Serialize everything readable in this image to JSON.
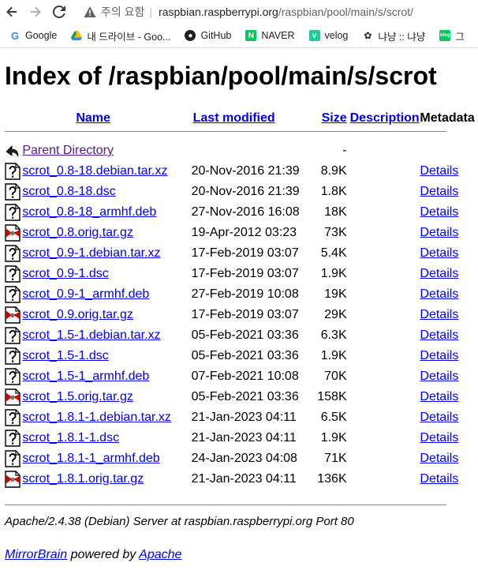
{
  "browser": {
    "back_icon": "arrow-left-icon",
    "forward_icon": "arrow-right-icon",
    "reload_icon": "reload-icon",
    "security_label": "주의 요함",
    "url_host": "raspbian.raspberrypi.org",
    "url_path": "/raspbian/pool/main/s/scrot/"
  },
  "bookmarks": [
    {
      "label": "Google",
      "icon": "google-icon"
    },
    {
      "label": "내 드라이브 - Goo...",
      "icon": "drive-icon"
    },
    {
      "label": "GitHub",
      "icon": "github-icon"
    },
    {
      "label": "NAVER",
      "icon": "naver-icon"
    },
    {
      "label": "velog",
      "icon": "velog-icon"
    },
    {
      "label": "냐냥 :: 냐냥",
      "icon": "bookmark-icon"
    },
    {
      "label": "그",
      "icon": "blog-icon"
    }
  ],
  "page": {
    "title": "Index of /raspbian/pool/main/s/scrot",
    "headers": {
      "name": "Name",
      "last_modified": "Last modified",
      "size": "Size",
      "description": "Description",
      "metadata": "Metadata"
    },
    "parent": {
      "label": "Parent Directory",
      "size": "-"
    },
    "rows": [
      {
        "name": "scrot_0.8-18.debian.tar.xz",
        "date": "20-Nov-2016 21:39",
        "size": "8.9K",
        "details": "Details",
        "kind": "unknown"
      },
      {
        "name": "scrot_0.8-18.dsc",
        "date": "20-Nov-2016 21:39",
        "size": "1.8K",
        "details": "Details",
        "kind": "unknown"
      },
      {
        "name": "scrot_0.8-18_armhf.deb",
        "date": "27-Nov-2016 16:08",
        "size": "18K",
        "details": "Details",
        "kind": "unknown"
      },
      {
        "name": "scrot_0.8.orig.tar.gz",
        "date": "19-Apr-2012 03:23",
        "size": "73K",
        "details": "Details",
        "kind": "compressed"
      },
      {
        "name": "scrot_0.9-1.debian.tar.xz",
        "date": "17-Feb-2019 03:07",
        "size": "5.4K",
        "details": "Details",
        "kind": "unknown"
      },
      {
        "name": "scrot_0.9-1.dsc",
        "date": "17-Feb-2019 03:07",
        "size": "1.9K",
        "details": "Details",
        "kind": "unknown"
      },
      {
        "name": "scrot_0.9-1_armhf.deb",
        "date": "27-Feb-2019 10:08",
        "size": "19K",
        "details": "Details",
        "kind": "unknown"
      },
      {
        "name": "scrot_0.9.orig.tar.gz",
        "date": "17-Feb-2019 03:07",
        "size": "29K",
        "details": "Details",
        "kind": "compressed"
      },
      {
        "name": "scrot_1.5-1.debian.tar.xz",
        "date": "05-Feb-2021 03:36",
        "size": "6.3K",
        "details": "Details",
        "kind": "unknown"
      },
      {
        "name": "scrot_1.5-1.dsc",
        "date": "05-Feb-2021 03:36",
        "size": "1.9K",
        "details": "Details",
        "kind": "unknown"
      },
      {
        "name": "scrot_1.5-1_armhf.deb",
        "date": "07-Feb-2021 10:08",
        "size": "70K",
        "details": "Details",
        "kind": "unknown"
      },
      {
        "name": "scrot_1.5.orig.tar.gz",
        "date": "05-Feb-2021 03:36",
        "size": "158K",
        "details": "Details",
        "kind": "compressed"
      },
      {
        "name": "scrot_1.8.1-1.debian.tar.xz",
        "date": "21-Jan-2023 04:11",
        "size": "6.5K",
        "details": "Details",
        "kind": "unknown"
      },
      {
        "name": "scrot_1.8.1-1.dsc",
        "date": "21-Jan-2023 04:11",
        "size": "1.9K",
        "details": "Details",
        "kind": "unknown"
      },
      {
        "name": "scrot_1.8.1-1_armhf.deb",
        "date": "24-Jan-2023 04:08",
        "size": "71K",
        "details": "Details",
        "kind": "unknown"
      },
      {
        "name": "scrot_1.8.1.orig.tar.gz",
        "date": "21-Jan-2023 04:11",
        "size": "136K",
        "details": "Details",
        "kind": "compressed"
      }
    ],
    "server_line": "Apache/2.4.38 (Debian) Server at raspbian.raspberrypi.org Port 80",
    "footer": {
      "mirrorbrain": "MirrorBrain",
      "powered_by": " powered by ",
      "apache": "Apache"
    }
  },
  "colors": {
    "link": "#0000ee",
    "visited": "#551a8b"
  }
}
